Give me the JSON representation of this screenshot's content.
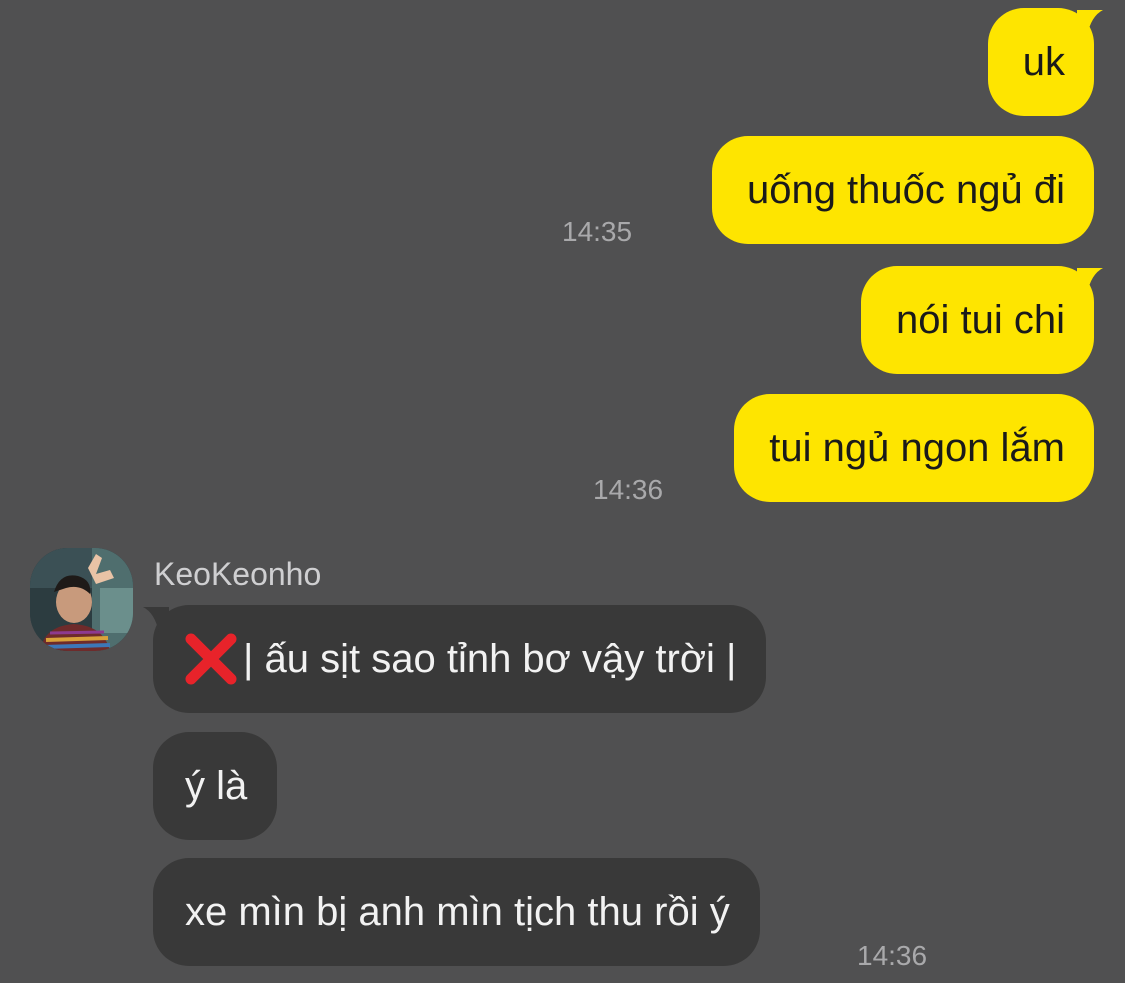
{
  "outgoing": [
    {
      "text": "uk"
    },
    {
      "text": "uống thuốc ngủ đi",
      "time": "14:35"
    },
    {
      "text": "nói tui chi"
    },
    {
      "text": "tui ngủ ngon lắm",
      "time": "14:36"
    }
  ],
  "incoming": {
    "sender": "KeoKeonho",
    "avatar_icon": "profile-photo",
    "messages": [
      {
        "icon": "cross-mark-icon",
        "text": "| ấu sịt sao tỉnh bơ vậy trời |"
      },
      {
        "text": "ý là"
      },
      {
        "text": "xe mìn bị anh mìn tịch thu rồi ý",
        "time": "14:36"
      }
    ]
  },
  "colors": {
    "background": "#505051",
    "outgoing_bubble": "#FEE500",
    "incoming_bubble": "#393939",
    "timestamp": "#a9a9ab",
    "cross_mark": "#e8232a"
  }
}
